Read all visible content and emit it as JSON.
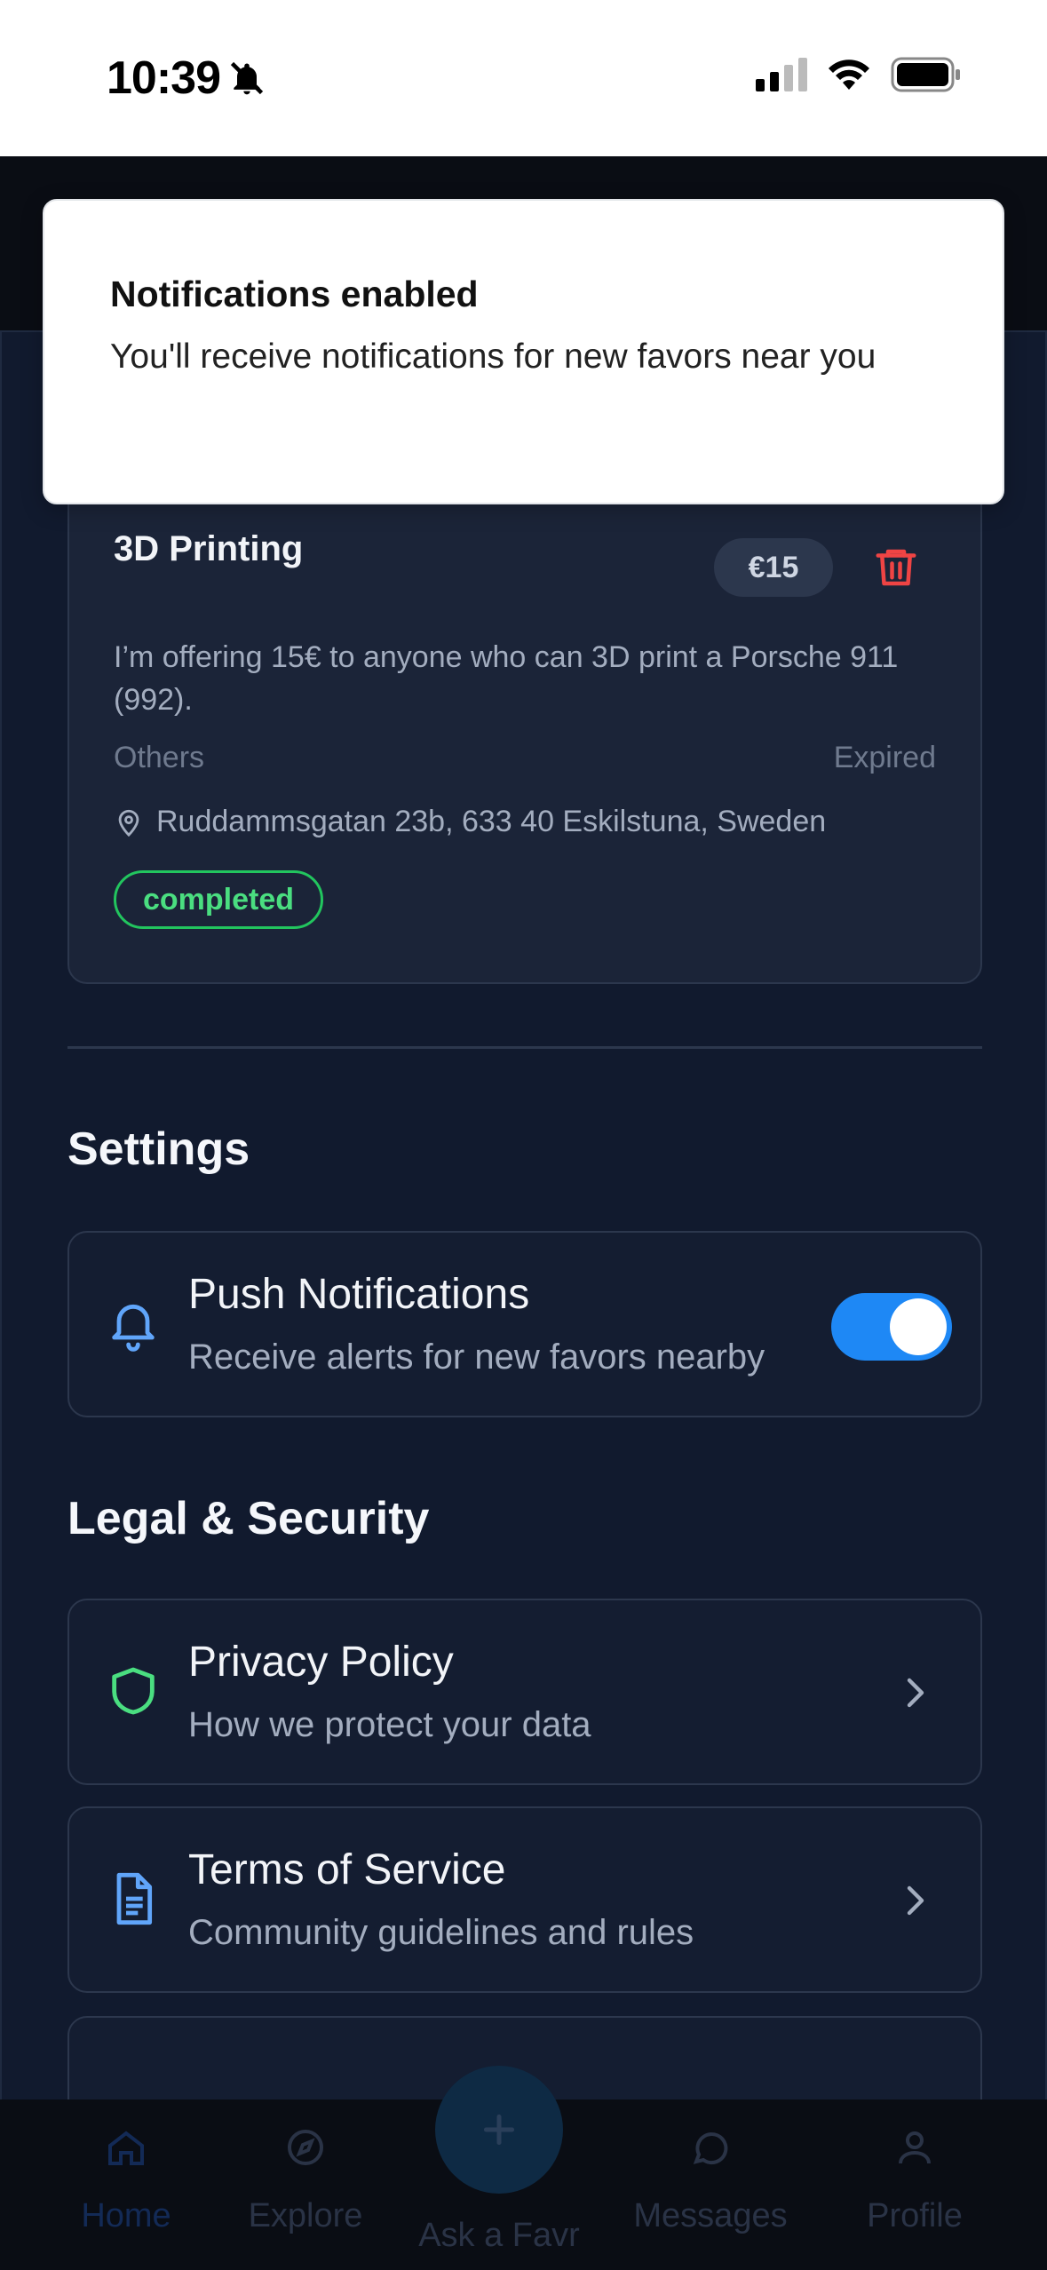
{
  "status_bar": {
    "time": "10:39"
  },
  "toast": {
    "title": "Notifications enabled",
    "body": "You'll receive notifications for new favors near you"
  },
  "favor": {
    "title": "3D Printing",
    "price": "€15",
    "description": "I’m offering 15€ to anyone who can 3D print a Porsche 911 (992).",
    "category": "Others",
    "expiry": "Expired",
    "location": "Ruddammsgatan 23b, 633 40 Eskilstuna, Sweden",
    "status": "completed"
  },
  "settings": {
    "title": "Settings",
    "push": {
      "title": "Push Notifications",
      "subtitle": "Receive alerts for new favors nearby",
      "enabled": true
    }
  },
  "legal": {
    "title": "Legal & Security",
    "items": [
      {
        "title": "Privacy Policy",
        "subtitle": "How we protect your data",
        "icon": "shield-icon"
      },
      {
        "title": "Terms of Service",
        "subtitle": "Community guidelines and rules",
        "icon": "document-icon"
      }
    ]
  },
  "nav": {
    "items": [
      {
        "label": "Home",
        "icon": "home-icon",
        "active": true
      },
      {
        "label": "Explore",
        "icon": "compass-icon"
      },
      {
        "label": "Ask a Favr",
        "icon": "plus-icon"
      },
      {
        "label": "Messages",
        "icon": "chat-icon"
      },
      {
        "label": "Profile",
        "icon": "user-icon"
      }
    ]
  },
  "colors": {
    "accent": "#1e88f5",
    "success": "#22c55e",
    "danger": "#ef4444",
    "background": "#111a2e"
  }
}
